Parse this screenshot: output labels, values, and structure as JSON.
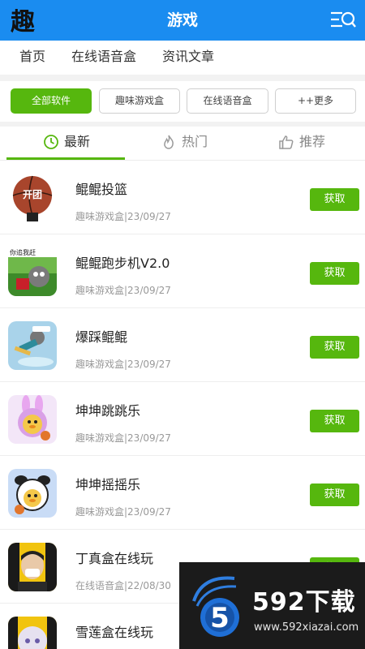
{
  "header": {
    "title": "游戏",
    "logo_text": "趣",
    "color": "#1a8cf0"
  },
  "topnav": {
    "items": [
      "首页",
      "在线语音盒",
      "资讯文章"
    ]
  },
  "filters": {
    "chips": [
      "全部软件",
      "趣味游戏盒",
      "在线语音盒",
      "++更多"
    ],
    "active_index": 0,
    "accent": "#56b70e"
  },
  "tabs": [
    {
      "label": "最新",
      "icon": "clock-icon",
      "active": true
    },
    {
      "label": "热门",
      "icon": "flame-icon",
      "active": false
    },
    {
      "label": "推荐",
      "icon": "thumbs-up-icon",
      "active": false
    }
  ],
  "apps": [
    {
      "name": "鲲鲲投篮",
      "meta": "趣味游戏盒|23/09/27",
      "button": "获取",
      "icon_text": "开团",
      "icon": "basketball-icon"
    },
    {
      "name": "鲲鲲跑步机V2.0",
      "meta": "趣味游戏盒|23/09/27",
      "button": "获取",
      "icon_text": "你追我赶",
      "icon": "cartoon-runner-icon"
    },
    {
      "name": "爆踩鲲鲲",
      "meta": "趣味游戏盒|23/09/27",
      "button": "获取",
      "icon_text": "",
      "icon": "cartoon-fall-icon"
    },
    {
      "name": "坤坤跳跳乐",
      "meta": "趣味游戏盒|23/09/27",
      "button": "获取",
      "icon_text": "",
      "icon": "bunny-chick-icon"
    },
    {
      "name": "坤坤摇摇乐",
      "meta": "趣味游戏盒|23/09/27",
      "button": "获取",
      "icon_text": "",
      "icon": "panda-chick-icon"
    },
    {
      "name": "丁真盒在线玩",
      "meta": "在线语音盒|22/08/30",
      "button": "获取",
      "icon_text": "",
      "icon": "portrait-icon"
    },
    {
      "name": "雪莲盒在线玩",
      "meta": "",
      "button": "",
      "icon_text": "",
      "icon": "anime-portrait-icon"
    }
  ],
  "watermark": {
    "brand": "592下载",
    "url": "www.592xiazai.com",
    "logo_char": "5"
  }
}
